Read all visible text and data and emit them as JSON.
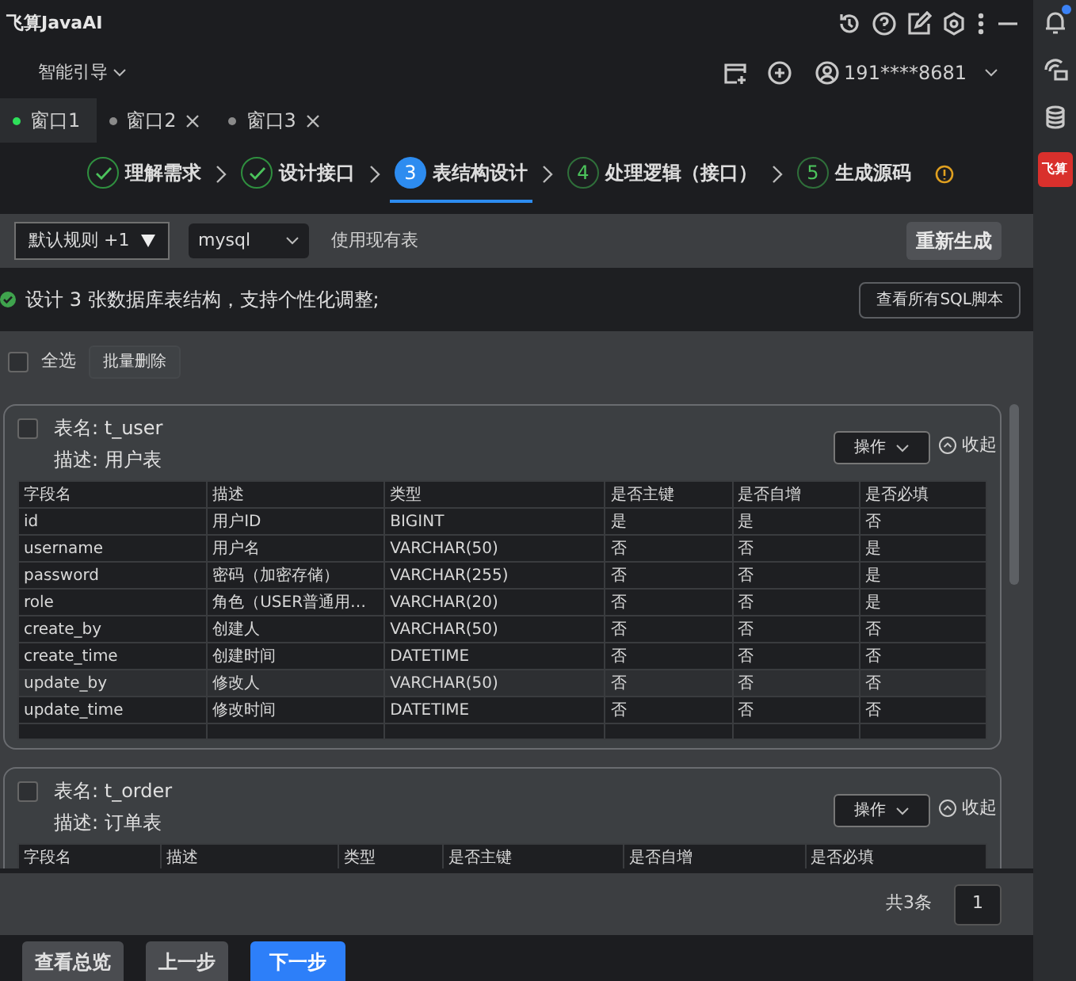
{
  "app": {
    "title": "飞算JavaAI",
    "guide": "智能引导",
    "user": "191****8681"
  },
  "window_tabs": [
    {
      "label": "窗口1",
      "selected": true,
      "closable": false
    },
    {
      "label": "窗口2",
      "selected": false,
      "closable": true
    },
    {
      "label": "窗口3",
      "selected": false,
      "closable": true
    }
  ],
  "steps": [
    {
      "completed": true,
      "selected": false,
      "label": "理解需求"
    },
    {
      "completed": true,
      "selected": false,
      "label": "设计接口"
    },
    {
      "completed": false,
      "selected": true,
      "number": "3",
      "label": "表结构设计"
    },
    {
      "completed": false,
      "selected": false,
      "number": "4",
      "label": "处理逻辑（接口）"
    },
    {
      "completed": false,
      "selected": false,
      "number": "5",
      "label": "生成源码"
    }
  ],
  "toolbar": {
    "rule_select": "默认规则 +1",
    "db_select": "mysql",
    "use_existing": "使用现有表",
    "regenerate": "重新生成"
  },
  "info": {
    "message": "设计 3 张数据库表结构，支持个性化调整;",
    "view_sql": "查看所有SQL脚本"
  },
  "bulk": {
    "select_all": {
      "label": "全选",
      "checked": false
    },
    "batch_delete": "批量删除"
  },
  "tables": [
    {
      "checked": false,
      "name": "表名: t_user",
      "description": "描述: 用户表",
      "actions": "操作",
      "collapse": "收起",
      "columns": [
        "字段名",
        "描述",
        "类型",
        "是否主键",
        "是否自增",
        "是否必填"
      ],
      "rows": [
        {
          "hovered": false,
          "cells": [
            "id",
            "用户ID",
            "BIGINT",
            "是",
            "是",
            "否"
          ]
        },
        {
          "hovered": false,
          "cells": [
            "username",
            "用户名",
            "VARCHAR(50)",
            "否",
            "否",
            "是"
          ]
        },
        {
          "hovered": false,
          "cells": [
            "password",
            "密码（加密存储）",
            "VARCHAR(255)",
            "否",
            "否",
            "是"
          ]
        },
        {
          "hovered": false,
          "cells": [
            "role",
            "角色（USER普通用…",
            "VARCHAR(20)",
            "否",
            "否",
            "是"
          ]
        },
        {
          "hovered": false,
          "cells": [
            "create_by",
            "创建人",
            "VARCHAR(50)",
            "否",
            "否",
            "否"
          ]
        },
        {
          "hovered": false,
          "cells": [
            "create_time",
            "创建时间",
            "DATETIME",
            "否",
            "否",
            "否"
          ]
        },
        {
          "hovered": true,
          "cells": [
            "update_by",
            "修改人",
            "VARCHAR(50)",
            "否",
            "否",
            "否"
          ]
        },
        {
          "hovered": false,
          "cells": [
            "update_time",
            "修改时间",
            "DATETIME",
            "否",
            "否",
            "否"
          ]
        }
      ]
    },
    {
      "checked": false,
      "name": "表名: t_order",
      "description": "描述: 订单表",
      "actions": "操作",
      "collapse": "收起",
      "columns": [
        "字段名",
        "描述",
        "类型",
        "是否主键",
        "是否自增",
        "是否必填"
      ]
    }
  ],
  "pagination": {
    "total": "共3条",
    "page": "1"
  },
  "footer_buttons": [
    {
      "kind": "secondary",
      "label": "查看总览"
    },
    {
      "kind": "secondary",
      "label": "上一步"
    },
    {
      "kind": "primary",
      "label": "下一步"
    }
  ],
  "sidebar": {
    "logo": "飞算",
    "notification": true
  }
}
